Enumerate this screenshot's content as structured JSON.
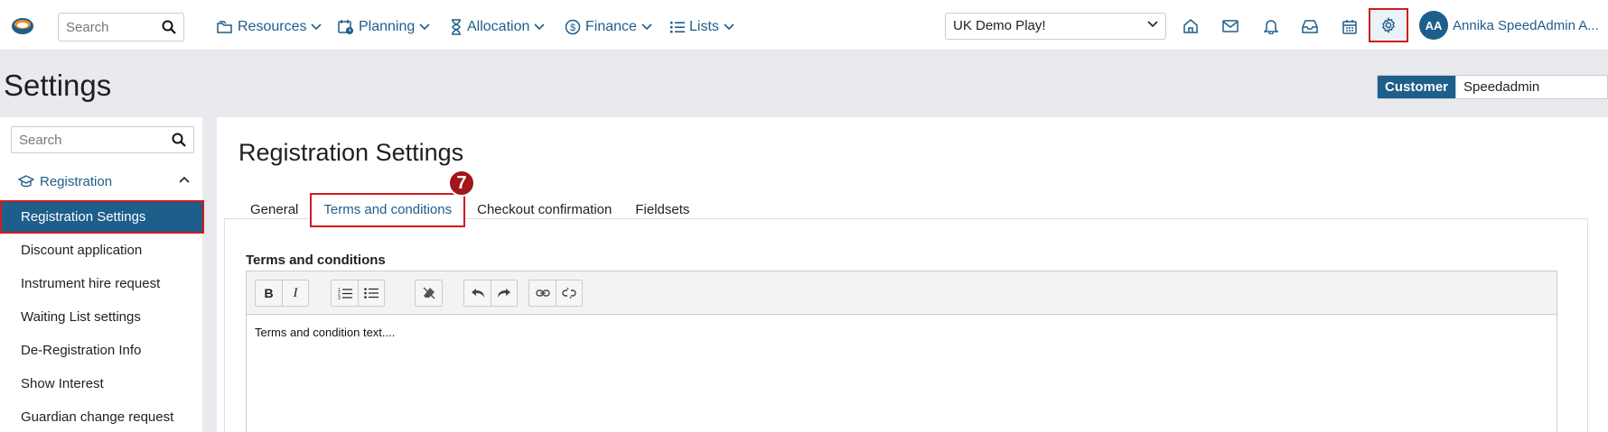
{
  "topbar": {
    "search_placeholder": "Search",
    "nav": [
      {
        "label": "Resources",
        "icon": "folders-icon"
      },
      {
        "label": "Planning",
        "icon": "calendar-clock-icon"
      },
      {
        "label": "Allocation",
        "icon": "hourglass-icon"
      },
      {
        "label": "Finance",
        "icon": "dollar-icon"
      },
      {
        "label": "Lists",
        "icon": "list-icon"
      }
    ],
    "school_select": "UK Demo Play!",
    "icons": [
      "home-icon",
      "mail-icon",
      "bell-icon",
      "inbox-icon",
      "calendar-icon",
      "gear-icon"
    ],
    "avatar_initials": "AA",
    "user_name": "Annika SpeedAdmin A..."
  },
  "page": {
    "title": "Settings",
    "role_toggle": {
      "active": "Customer",
      "inactive": "Speedadmin Employee"
    }
  },
  "sidebar": {
    "search_placeholder": "Search",
    "group": {
      "label": "Registration",
      "icon": "graduation-cap-icon"
    },
    "items": [
      {
        "label": "Registration Settings",
        "active": true
      },
      {
        "label": "Discount application"
      },
      {
        "label": "Instrument hire request"
      },
      {
        "label": "Waiting List settings"
      },
      {
        "label": "De-Registration Info"
      },
      {
        "label": "Show Interest"
      },
      {
        "label": "Guardian change request"
      }
    ]
  },
  "main": {
    "title": "Registration Settings",
    "tabs": [
      {
        "label": "General"
      },
      {
        "label": "Terms and conditions",
        "active": true
      },
      {
        "label": "Checkout confirmation"
      },
      {
        "label": "Fieldsets"
      }
    ],
    "step_badge": "7",
    "field_label": "Terms and conditions",
    "toolbar": {
      "bold": "B",
      "italic": "I"
    },
    "editor_text": "Terms and condition text...."
  },
  "colors": {
    "accent": "#1e5e8a",
    "highlight": "#d01c1f",
    "badge": "#a1151b"
  }
}
